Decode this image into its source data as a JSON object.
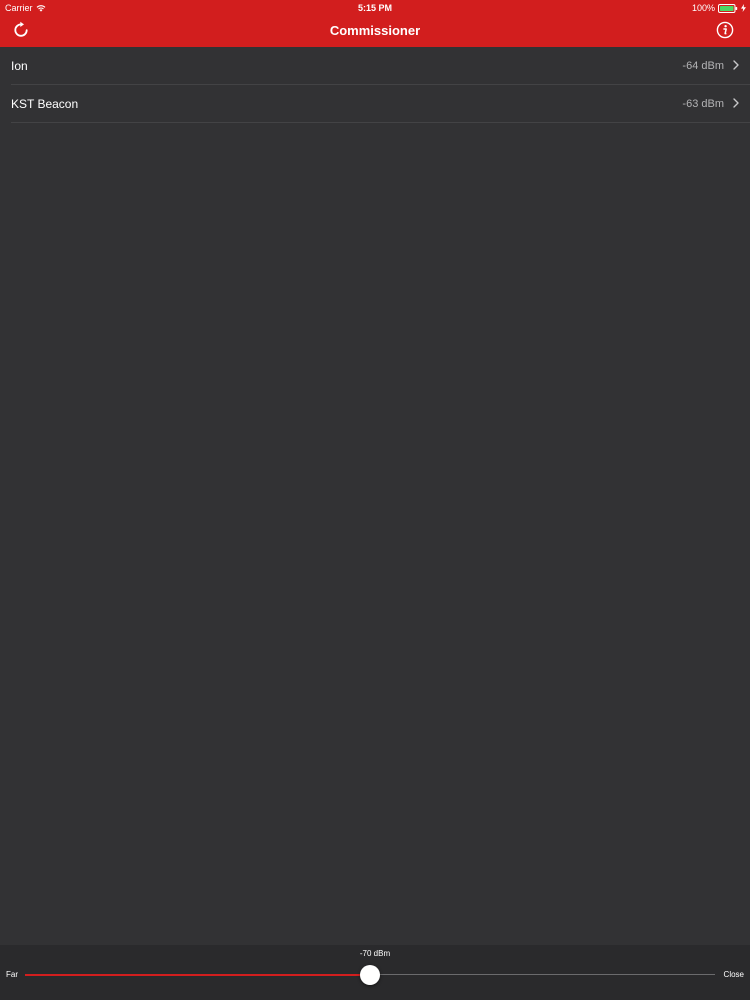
{
  "theme": {
    "accent": "#d21e1e",
    "background": "#323234",
    "bottom_bar": "#2a2a2c"
  },
  "status_bar": {
    "carrier": "Carrier",
    "time": "5:15 PM",
    "battery": "100%",
    "icons": [
      "wifi-icon",
      "battery-icon",
      "charging-bolt-icon"
    ]
  },
  "nav": {
    "title": "Commissioner",
    "left_icon": "refresh-icon",
    "right_icon": "info-icon"
  },
  "beacons": [
    {
      "name": "Ion",
      "signal": "-64 dBm"
    },
    {
      "name": "KST Beacon",
      "signal": "-63 dBm"
    }
  ],
  "slider": {
    "value_label": "-70 dBm",
    "min_label": "Far",
    "max_label": "Close",
    "fraction": 0.5
  }
}
